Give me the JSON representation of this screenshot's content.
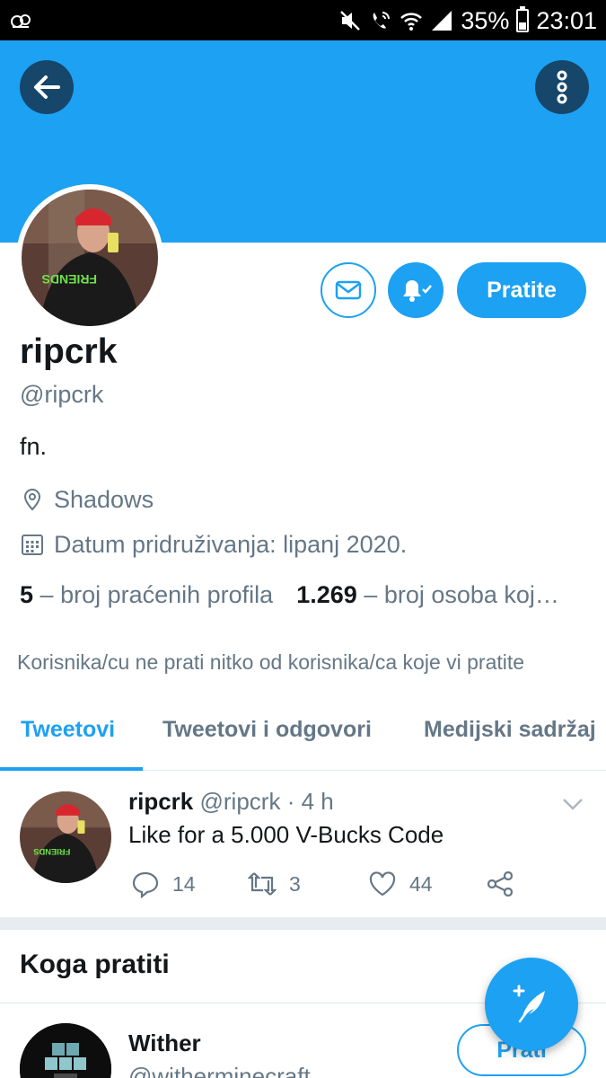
{
  "status_bar": {
    "battery": "35%",
    "time": "23:01",
    "battery_level": 0.35
  },
  "header": {
    "back_icon": "arrow-left-icon",
    "more_icon": "more-vertical-icon"
  },
  "profile": {
    "name": "ripcrk",
    "handle": "@ripcrk",
    "bio": "fn.",
    "location": "Shadows",
    "joined": "Datum pridruživanja: lipanj 2020.",
    "following_count": "5",
    "following_label": "– broj praćenih profila",
    "followers_count": "1.269",
    "followers_label": "– broj osoba koj…",
    "not_followed_note": "Korisnika/cu ne prati nitko od korisnika/ca koje vi pratite",
    "follow_button": "Pratite"
  },
  "tabs": [
    {
      "label": "Tweetovi",
      "active": true
    },
    {
      "label": "Tweetovi i odgovori",
      "active": false
    },
    {
      "label": "Medijski sadržaj",
      "active": false
    }
  ],
  "tweet": {
    "author_name": "ripcrk",
    "author_handle": "@ripcrk",
    "separator": "·",
    "time": "4 h",
    "text": "Like for a 5.000 V-Bucks Code",
    "replies": "14",
    "retweets": "3",
    "likes": "44"
  },
  "who_to_follow": {
    "title": "Koga pratiti",
    "suggestion": {
      "name": "Wither",
      "handle": "@witherminecraft",
      "follow_label": "Prati"
    }
  },
  "colors": {
    "accent": "#1da1f2",
    "banner": "#1da1f2",
    "button_dark": "#17466b",
    "muted_text": "#657786",
    "primary_text": "#14171a"
  }
}
